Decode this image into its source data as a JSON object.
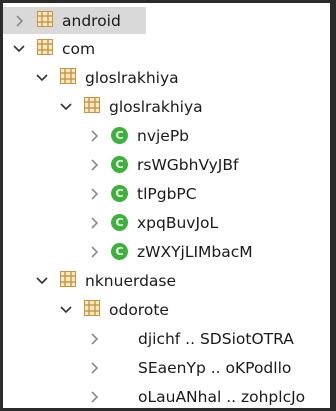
{
  "tree": {
    "nodes": [
      {
        "label": "android",
        "icon": "package-icon",
        "chevron": "right",
        "selected": true
      },
      {
        "label": "com",
        "icon": "package-icon",
        "chevron": "down"
      },
      {
        "label": "gloslrakhiya",
        "icon": "package-icon",
        "chevron": "down"
      },
      {
        "label": "gloslrakhiya",
        "icon": "package-icon",
        "chevron": "down"
      },
      {
        "label": "nvjePb",
        "icon": "class-icon",
        "chevron": "right"
      },
      {
        "label": "rsWGbhVyJBf",
        "icon": "class-icon",
        "chevron": "right"
      },
      {
        "label": "tlPgbPC",
        "icon": "class-icon",
        "chevron": "right"
      },
      {
        "label": "xpqBuvJoL",
        "icon": "class-icon",
        "chevron": "right"
      },
      {
        "label": "zWXYjLIMbacM",
        "icon": "class-icon",
        "chevron": "right"
      },
      {
        "label": "nknuerdase",
        "icon": "package-icon",
        "chevron": "down"
      },
      {
        "label": "odorote",
        "icon": "package-icon",
        "chevron": "down"
      },
      {
        "label": "djichf .. SDSiotOTRA",
        "icon": "none",
        "chevron": "right"
      },
      {
        "label": "SEaenYp .. oKPodllo",
        "icon": "none",
        "chevron": "right"
      },
      {
        "label": "oLauANhal .. zohplcJo",
        "icon": "none",
        "chevron": "right"
      }
    ],
    "class_icon_letter": "C"
  },
  "colors": {
    "background": "#2b2b2b",
    "panel": "#ffffff",
    "selected_row": "#d9d9d9",
    "class_icon": "#3bb33b",
    "package_icon": "#c8953c",
    "chevron": "#8a8a8a",
    "chevron_dark": "#333333"
  }
}
